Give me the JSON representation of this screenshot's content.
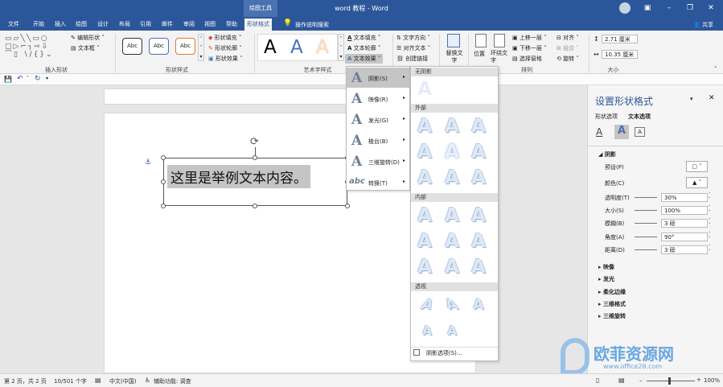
{
  "app": {
    "title": "word 教程 - Word",
    "context_tab_group": "绘图工具"
  },
  "tabs": [
    "文件",
    "开始",
    "插入",
    "绘图",
    "设计",
    "布局",
    "引用",
    "邮件",
    "审阅",
    "视图",
    "帮助",
    "形状格式"
  ],
  "tell_me": "操作说明搜索",
  "share": "共享",
  "ribbon": {
    "insert_shapes": {
      "label": "插入形状",
      "edit_shape": "编辑形状",
      "text_box": "文本框"
    },
    "shape_styles": {
      "label": "形状样式",
      "sample": "Abc",
      "fill": "形状填充",
      "outline": "形状轮廓",
      "effects": "形状效果"
    },
    "wordart_styles": {
      "label": "艺术字样式",
      "sample": "A",
      "text_fill": "文本填充",
      "text_outline": "文本轮廓",
      "text_effects": "文本效果"
    },
    "text": {
      "direction": "文字方向",
      "align": "对齐文本",
      "link": "创建链接"
    },
    "alt_text": "替换文字",
    "arrange": {
      "label": "排列",
      "position": "位置",
      "wrap": "环绕文字",
      "forward": "上移一层",
      "backward": "下移一层",
      "selection_pane": "选择窗格",
      "align": "对齐",
      "group": "组合",
      "rotate": "旋转"
    },
    "size": {
      "label": "大小",
      "height": "2.71 厘米",
      "width": "10.35 厘米"
    }
  },
  "document": {
    "text": "这里是举例文本内容。"
  },
  "effects_menu": {
    "items": [
      {
        "label": "阴影(S)",
        "icon": "A"
      },
      {
        "label": "映像(R)",
        "icon": "A"
      },
      {
        "label": "发光(G)",
        "icon": "A"
      },
      {
        "label": "棱台(B)",
        "icon": "A"
      },
      {
        "label": "三维旋转(D)",
        "icon": "A"
      },
      {
        "label": "转换(T)",
        "icon": "abc"
      }
    ]
  },
  "shadow_gallery": {
    "no_shadow": "无阴影",
    "outer": "外部",
    "inner": "内部",
    "perspective": "透视",
    "options": "阴影选项(S)..."
  },
  "format_pane": {
    "title": "设置形状格式",
    "tab_shape": "形状选项",
    "tab_text": "文本选项",
    "sections": {
      "shadow": "阴影",
      "reflection": "映像",
      "glow": "发光",
      "soft_edges": "柔化边缘",
      "format_3d": "三维格式",
      "rotation_3d": "三维旋转"
    },
    "props": [
      {
        "label": "预设(P)",
        "value": ""
      },
      {
        "label": "颜色(C)",
        "value": ""
      },
      {
        "label": "透明度(T)",
        "value": "30%"
      },
      {
        "label": "大小(S)",
        "value": "100%"
      },
      {
        "label": "模糊(B)",
        "value": "3 磅"
      },
      {
        "label": "角度(A)",
        "value": "90°"
      },
      {
        "label": "距离(D)",
        "value": "3 磅"
      }
    ]
  },
  "status": {
    "page": "第 2 页，共 2 页",
    "words": "10/501 个字",
    "lang": "中文(中国)",
    "accessibility": "辅助功能: 调查",
    "zoom": "100%"
  },
  "watermark": {
    "name": "欧菲资源网",
    "url": "www.office26.com"
  },
  "colors": {
    "brand": "#2b579a",
    "selection": "#c5c5c5"
  }
}
